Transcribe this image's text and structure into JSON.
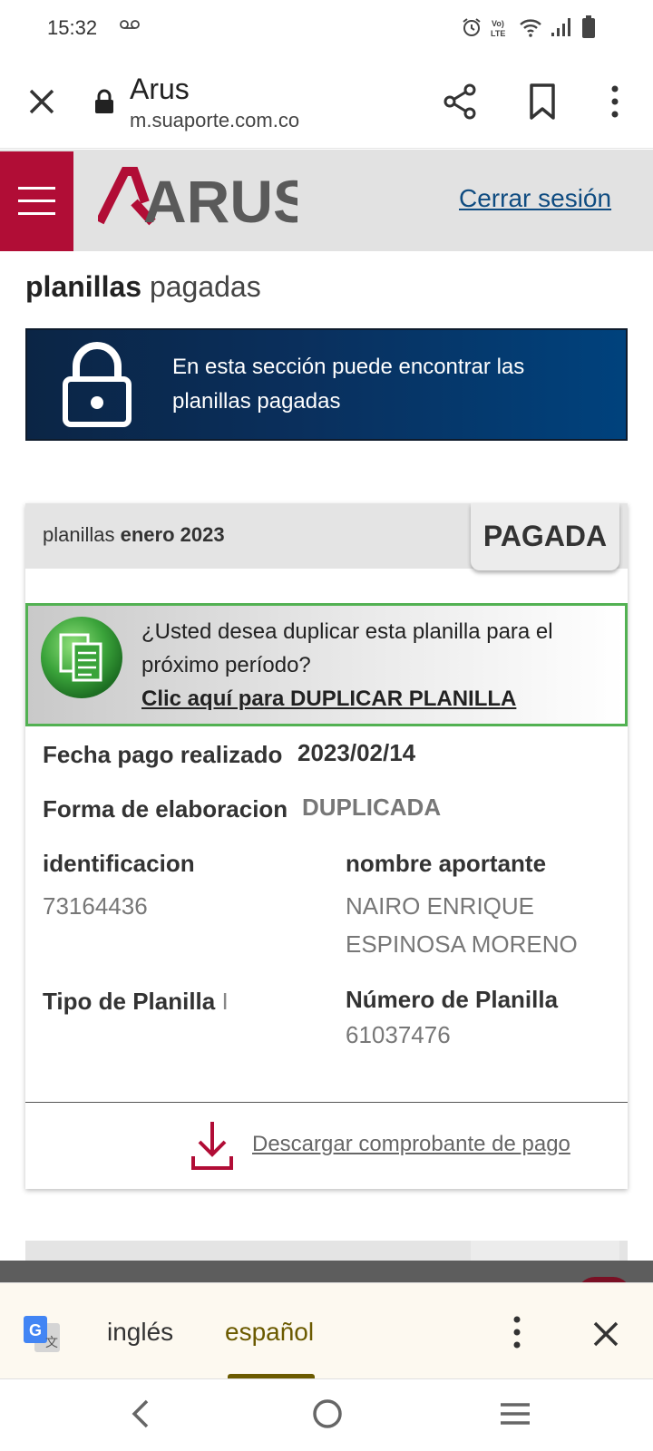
{
  "status_bar": {
    "time": "15:32",
    "icons": [
      "voicemail-icon",
      "alarm-icon",
      "volte-icon",
      "wifi-icon",
      "signal-icon",
      "battery-icon"
    ]
  },
  "browser": {
    "title": "Arus",
    "url": "m.suaporte.com.co",
    "icons": [
      "close-icon",
      "lock-icon",
      "share-icon",
      "bookmark-icon",
      "more-vert-icon"
    ]
  },
  "header": {
    "logo_text": "ARUS",
    "logout_label": "Cerrar sesión",
    "brand_color": "#b10d36"
  },
  "page": {
    "title_bold": "planillas",
    "title_rest": "pagadas"
  },
  "banner": {
    "text": "En esta sección puede encontrar las planillas pagadas"
  },
  "card": {
    "head_prefix": "planillas",
    "head_period": "enero 2023",
    "status": "PAGADA",
    "duplicate": {
      "question": "¿Usted desea duplicar esta planilla para el próximo período?",
      "link": "Clic aquí para DUPLICAR PLANILLA"
    },
    "fields": {
      "fecha_label": "Fecha pago realizado",
      "fecha_value": "2023/02/14",
      "forma_label": "Forma de elaboracion",
      "forma_value": "DUPLICADA",
      "id_label": "identificacion",
      "id_value": "73164436",
      "nombre_label": "nombre aportante",
      "nombre_value_1": "NAIRO ENRIQUE",
      "nombre_value_2": "ESPINOSA MORENO",
      "tipo_label": "Tipo de Planilla",
      "tipo_value": "I",
      "numero_label": "Número de Planilla",
      "numero_value": "61037476"
    },
    "download_label": "Descargar comprobante de pago"
  },
  "translate_bar": {
    "lang_source": "inglés",
    "lang_target": "español",
    "selected": "español"
  },
  "nav_bar": {
    "icons": [
      "back-icon",
      "home-icon",
      "recent-apps-icon"
    ]
  }
}
